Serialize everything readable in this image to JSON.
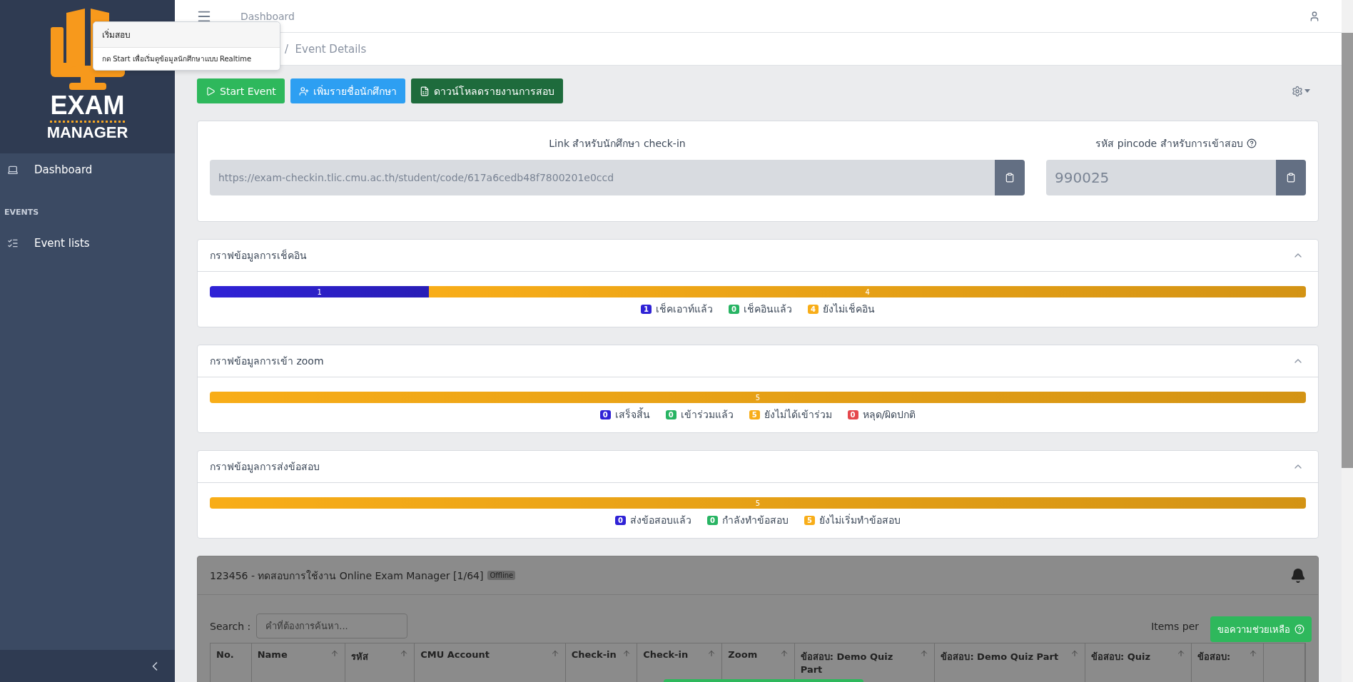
{
  "sidebar": {
    "logo_lines": [
      "EXAM",
      "MANAGER"
    ],
    "items": [
      {
        "kind": "link",
        "label": "Dashboard",
        "selected": false
      },
      {
        "kind": "heading",
        "label": "EVENTS"
      },
      {
        "kind": "link",
        "label": "Event lists",
        "selected": false
      }
    ]
  },
  "topbar": {
    "title": "Dashboard"
  },
  "breadcrumb": {
    "separator": "/",
    "current": "Event Details"
  },
  "popover": {
    "title": "เริ่มสอบ",
    "body": "กด Start เพื่อเริ่มดูข้อมูลนักศึกษาแบบ Realtime"
  },
  "actions": [
    {
      "kind": "start",
      "label": "Start Event"
    },
    {
      "kind": "add",
      "label": "เพิ่มรายชื่อนักศึกษา"
    },
    {
      "kind": "download",
      "label": "ดาวน์โหลดรายงานการสอบ"
    }
  ],
  "link_card": {
    "link_label": "Link สำหรับนักศึกษา check-in",
    "link_value": "https://exam-checkin.tlic.cmu.ac.th/student/code/617a6cedb48f7800201e0ccd",
    "pin_label": "รหัส pincode สำหรับการเข้าสอบ",
    "pin_value": "990025"
  },
  "charts": [
    {
      "title": "กราฟข้อมูลการเช็คอิน",
      "expanded": true,
      "segments": [
        {
          "label": "1",
          "level": 0.2,
          "color": "#2f22d6"
        },
        {
          "label": "4",
          "level": 0.8,
          "color": "#f8ad18"
        }
      ],
      "legend": [
        {
          "count": "1",
          "label": "เช็คเอาท์แล้ว",
          "color": "#2f22d6"
        },
        {
          "count": "0",
          "label": "เช็คอินแล้ว",
          "color": "#28b463"
        },
        {
          "count": "4",
          "label": "ยังไม่เช็คอิน",
          "color": "#f8ad18"
        }
      ]
    },
    {
      "title": "กราฟข้อมูลการเข้า zoom",
      "expanded": true,
      "segments": [
        {
          "label": "5",
          "level": 1,
          "color": "#f8ad18"
        }
      ],
      "legend": [
        {
          "count": "0",
          "label": "เสร็จสิ้น",
          "color": "#2f22d6"
        },
        {
          "count": "0",
          "label": "เข้าร่วมแล้ว",
          "color": "#28b463"
        },
        {
          "count": "5",
          "label": "ยังไม่ได้เข้าร่วม",
          "color": "#f8ad18"
        },
        {
          "count": "0",
          "label": "หลุด/ผิดปกติ",
          "color": "#e5484d"
        }
      ]
    },
    {
      "title": "กราฟข้อมูลการส่งข้อสอบ",
      "expanded": true,
      "segments": [
        {
          "label": "5",
          "level": 1,
          "color": "#f8ad18"
        }
      ],
      "legend": [
        {
          "count": "0",
          "label": "ส่งข้อสอบแล้ว",
          "color": "#2f22d6"
        },
        {
          "count": "0",
          "label": "กำลังทำข้อสอบ",
          "color": "#28b463"
        },
        {
          "count": "5",
          "label": "ยังไม่เริ่มทำข้อสอบ",
          "color": "#f8ad18"
        }
      ]
    }
  ],
  "table_card": {
    "title": "123456 - ทดสอบการใช้งาน Online Exam Manager [1/64]",
    "status": "Offline",
    "search_label": "Search :",
    "search_placeholder": "คำที่ต้องการค้นหา...",
    "items_label": "Items per",
    "columns": [
      {
        "label": "No.",
        "sortable": false
      },
      {
        "label": "Name",
        "sortable": true
      },
      {
        "label": "รหัส",
        "sortable": true
      },
      {
        "label": "CMU Account",
        "sortable": true
      },
      {
        "label": "Check-in",
        "sortable": true
      },
      {
        "label": "Check-in",
        "sortable": true
      },
      {
        "label": "Zoom",
        "sortable": true
      },
      {
        "label": "ข้อสอบ: Demo Quiz Part",
        "sortable": true
      },
      {
        "label": "ข้อสอบ: Demo Quiz Part",
        "sortable": true
      },
      {
        "label": "ข้อสอบ: Quiz",
        "sortable": true
      },
      {
        "label": "ข้อสอบ:",
        "sortable": true
      },
      {
        "sortable": false
      }
    ]
  },
  "help_button": {
    "label": "ขอความช่วยเหลือ"
  }
}
